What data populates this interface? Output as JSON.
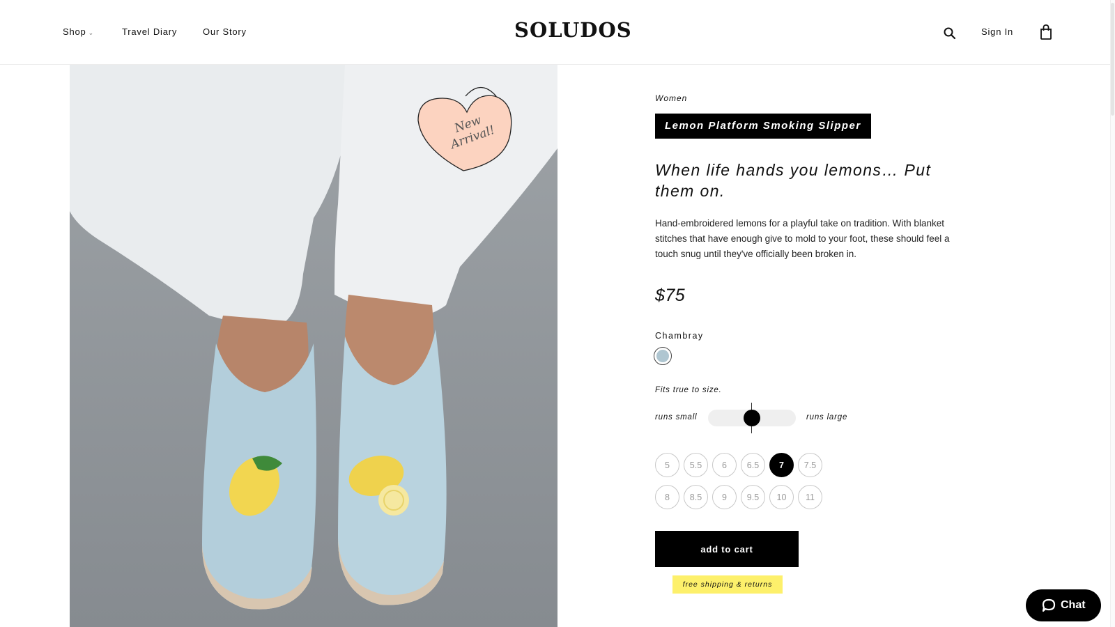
{
  "header": {
    "nav": [
      {
        "label": "Shop"
      },
      {
        "label": "Travel Diary"
      },
      {
        "label": "Our Story"
      }
    ],
    "logo_text": "SOLUDOS",
    "search_icon": "search-icon",
    "signin_label": "Sign In",
    "bag_icon": "shopping-bag-icon"
  },
  "photo": {
    "badge_text": [
      "New",
      "Arrival!"
    ],
    "badge_color": "#fcd3c0"
  },
  "product": {
    "category": "Women",
    "title": "Lemon Platform Smoking Slipper",
    "tagline": "When life hands you lemons… Put them on.",
    "description": "Hand-embroidered lemons for a playful take on tradition. With blanket stitches that have enough give to mold to your foot, these should feel a touch snug until they've officially been broken in.",
    "price": "$75",
    "color_name": "Chambray",
    "color_swatch": "#afc6d1",
    "fit": {
      "note": "Fits true to size.",
      "min_label": "runs small",
      "max_label": "runs large",
      "value": 0.5
    },
    "sizes": [
      "5",
      "5.5",
      "6",
      "6.5",
      "7",
      "7.5",
      "8",
      "8.5",
      "9",
      "9.5",
      "10",
      "11"
    ],
    "selected_size": "7",
    "add_to_cart_label": "add to cart",
    "shipping_note": "free shipping & returns"
  },
  "chat": {
    "label": "Chat",
    "icon": "chat-bubble-icon"
  },
  "colors": {
    "accent_yellow": "#fdf06b",
    "black": "#000000"
  }
}
